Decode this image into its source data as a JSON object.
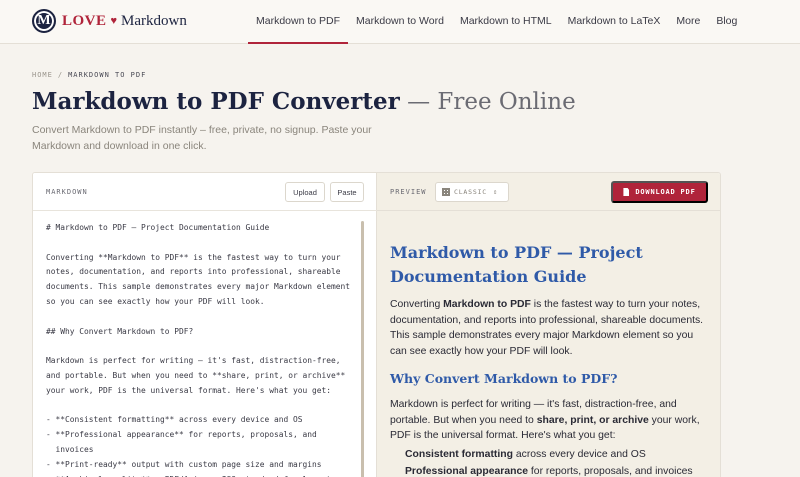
{
  "brand": {
    "logo_letter": "M",
    "love": "LOVE",
    "heart": "♥",
    "name": "Markdown"
  },
  "nav": {
    "links": [
      "Markdown to PDF",
      "Markdown to Word",
      "Markdown to HTML",
      "Markdown to LaTeX",
      "More",
      "Blog"
    ],
    "active_index": 0
  },
  "breadcrumb": {
    "home": "HOME",
    "sep": "/",
    "current": "MARKDOWN TO PDF"
  },
  "hero": {
    "title": "Markdown to PDF Converter",
    "title_suffix": " — Free Online",
    "subtitle": "Convert Markdown to PDF instantly – free, private, no signup. Paste your Markdown and download in one click."
  },
  "editor": {
    "label": "MARKDOWN",
    "upload_label": "Upload",
    "paste_label": "Paste",
    "lines": [
      "# Markdown to PDF — Project Documentation Guide",
      "",
      "Converting **Markdown to PDF** is the fastest way to turn your",
      "notes, documentation, and reports into professional, shareable",
      "documents. This sample demonstrates every major Markdown element",
      "so you can see exactly how your PDF will look.",
      "",
      "## Why Convert Markdown to PDF?",
      "",
      "Markdown is perfect for writing — it's fast, distraction-free,",
      "and portable. But when you need to **share, print, or archive**",
      "your work, PDF is the universal format. Here's what you get:",
      "",
      "- **Consistent formatting** across every device and OS",
      "- **Professional appearance** for reports, proposals, and",
      "  invoices",
      "- **Print-ready** output with custom page size and margins",
      "- **Archival quality** — PDF/A is an ISO standard for long-term"
    ]
  },
  "preview": {
    "label": "PREVIEW",
    "theme": "CLASSIC",
    "theme_chevron": "⇕",
    "download_label": "DOWNLOAD PDF",
    "h1": "Markdown to PDF — Project Documentation Guide",
    "p1_pre": "Converting ",
    "p1_bold": "Markdown to PDF",
    "p1_post": " is the fastest way to turn your notes, documentation, and reports into professional, shareable documents. This sample demonstrates every major Markdown element so you can see exactly how your PDF will look.",
    "h2": "Why Convert Markdown to PDF?",
    "p2_pre": "Markdown is perfect for writing — it's fast, distraction-free, and portable. But when you need to ",
    "p2_bold": "share, print, or archive",
    "p2_post": " your work, PDF is the universal format. Here's what you get:",
    "items": [
      {
        "bold": "Consistent formatting",
        "rest": " across every device and OS"
      },
      {
        "bold": "Professional appearance",
        "rest": " for reports, proposals, and invoices"
      }
    ]
  },
  "colors": {
    "accent": "#b0243a",
    "navy": "#1c2340",
    "heading_blue": "#2f5aa8",
    "preview_bg": "#f3efe5",
    "page_bg": "#f6f3ee"
  },
  "icons": {
    "logo": "m-circle-icon",
    "heart": "heart-icon",
    "theme": "grid-icon",
    "download": "file-icon",
    "chevron": "chevron-updown-icon"
  }
}
